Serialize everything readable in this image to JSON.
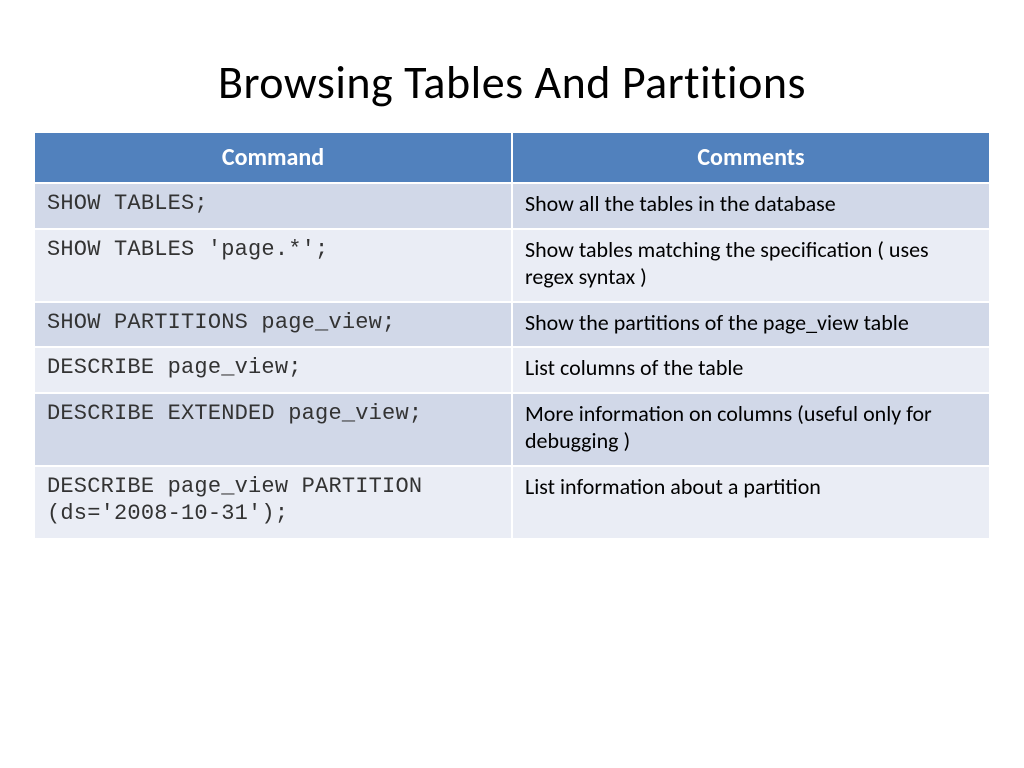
{
  "title": "Browsing Tables And Partitions",
  "headers": {
    "command": "Command",
    "comments": "Comments"
  },
  "rows": [
    {
      "command": "SHOW TABLES;",
      "comment": "Show all the tables in the database"
    },
    {
      "command": "SHOW TABLES 'page.*';",
      "comment": "Show tables matching the specification  ( uses regex syntax )"
    },
    {
      "command": "SHOW PARTITIONS page_view;",
      "comment": "Show the partitions of the page_view table"
    },
    {
      "command": "DESCRIBE page_view;",
      "comment": "List columns of the table"
    },
    {
      "command": "DESCRIBE EXTENDED page_view;",
      "comment": "More information on columns  (useful only for debugging )"
    },
    {
      "command": "DESCRIBE page_view PARTITION  (ds='2008-10-31');",
      "comment": "List information about a partition"
    }
  ],
  "chart_data": {
    "type": "table",
    "title": "Browsing Tables And Partitions",
    "columns": [
      "Command",
      "Comments"
    ],
    "rows": [
      [
        "SHOW TABLES;",
        "Show all the tables in the database"
      ],
      [
        "SHOW TABLES 'page.*';",
        "Show tables matching the specification  ( uses regex syntax )"
      ],
      [
        "SHOW PARTITIONS page_view;",
        "Show the partitions of the page_view table"
      ],
      [
        "DESCRIBE page_view;",
        "List columns of the table"
      ],
      [
        "DESCRIBE EXTENDED page_view;",
        "More information on columns  (useful only for debugging )"
      ],
      [
        "DESCRIBE page_view PARTITION  (ds='2008-10-31');",
        "List information about a partition"
      ]
    ]
  }
}
